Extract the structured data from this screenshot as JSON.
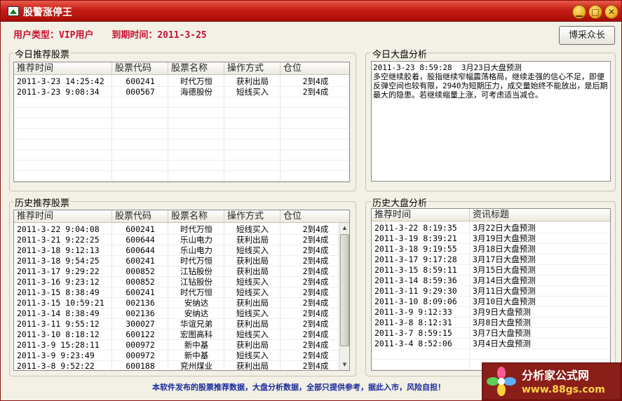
{
  "window": {
    "title": "股警涨停王",
    "controls": {
      "minimize": "▁",
      "maximize": "□",
      "close": "✕"
    }
  },
  "user_info": {
    "user_type_label": "用户类型：VIP用户",
    "expiry_label": "到期时间：2011-3-25"
  },
  "top_button": {
    "label": "博采众长"
  },
  "today_stocks": {
    "group_title": "今日推荐股票",
    "columns": [
      "推荐时间",
      "股票代码",
      "股票名称",
      "操作方式",
      "仓位"
    ],
    "rows": [
      [
        "2011-3-23 14:25:42",
        "600241",
        "时代万恒",
        "获利出局",
        "2到4成"
      ],
      [
        "2011-3-23 9:08:34",
        "000567",
        "海德股份",
        "短线买入",
        "2到4成"
      ]
    ]
  },
  "today_market": {
    "group_title": "今日大盘分析",
    "text": "2011-3-23 8:59:28  3月23日大盘预测\n多空继续胶着，股指继续窄幅震荡格局，继续走强的信心不足，即便反弹空间也较有限，2940为短期压力，成交量始终不能放出，是后期最大的隐患。若继续缩量上涨，可考虑适当减仓。"
  },
  "history_stocks": {
    "group_title": "历史推荐股票",
    "columns": [
      "推荐时间",
      "股票代码",
      "股票名称",
      "操作方式",
      "仓位"
    ],
    "rows": [
      [
        "2011-3-22 9:04:08",
        "600241",
        "时代万恒",
        "短线买入",
        "2到4成"
      ],
      [
        "2011-3-21 9:22:25",
        "600644",
        "乐山电力",
        "获利出局",
        "2到4成"
      ],
      [
        "2011-3-18 9:12:13",
        "600644",
        "乐山电力",
        "短线买入",
        "2到4成"
      ],
      [
        "2011-3-18 9:54:25",
        "600241",
        "时代万恒",
        "获利出局",
        "2到4成"
      ],
      [
        "2011-3-17 9:29:22",
        "000852",
        "江钻股份",
        "获利出局",
        "2到4成"
      ],
      [
        "2011-3-16 9:23:12",
        "000852",
        "江钻股份",
        "短线买入",
        "2到4成"
      ],
      [
        "2011-3-15 8:38:49",
        "600241",
        "时代万恒",
        "短线买入",
        "2到4成"
      ],
      [
        "2011-3-15 10:59:21",
        "002136",
        "安纳达",
        "获利出局",
        "2到4成"
      ],
      [
        "2011-3-14 8:38:49",
        "002136",
        "安纳达",
        "短线买入",
        "2到4成"
      ],
      [
        "2011-3-11 9:55:12",
        "300027",
        "华谊兄弟",
        "获利出局",
        "2到4成"
      ],
      [
        "2011-3-10 8:18:12",
        "600122",
        "宏图高科",
        "短线买入",
        "2到4成"
      ],
      [
        "2011-3-9 15:28:11",
        "000972",
        "新中基",
        "获利出局",
        "2到4成"
      ],
      [
        "2011-3-9 9:23:49",
        "000972",
        "新中基",
        "短线买入",
        "2到4成"
      ],
      [
        "2011-3-8 9:52:22",
        "600188",
        "兖州煤业",
        "获利出局",
        "2到4成"
      ]
    ]
  },
  "history_market": {
    "group_title": "历史大盘分析",
    "columns": [
      "推荐时间",
      "资讯标题"
    ],
    "rows": [
      [
        "2011-3-22 8:19:35",
        "3月22日大盘预测"
      ],
      [
        "2011-3-19 8:39:21",
        "3月19日大盘预测"
      ],
      [
        "2011-3-18 9:19:55",
        "3月18日大盘预测"
      ],
      [
        "2011-3-17 9:17:28",
        "3月17日大盘预测"
      ],
      [
        "2011-3-15 8:59:11",
        "3月15日大盘预测"
      ],
      [
        "2011-3-14 8:59:36",
        "3月14日大盘预测"
      ],
      [
        "2011-3-11 9:29:30",
        "3月11日大盘预测"
      ],
      [
        "2011-3-10 8:09:06",
        "3月10日大盘预测"
      ],
      [
        "2011-3-9 9:12:33",
        "3月9日大盘预测"
      ],
      [
        "2011-3-8 8:12:31",
        "3月8日大盘预测"
      ],
      [
        "2011-3-7 8:59:15",
        "3月7日大盘预测"
      ],
      [
        "2011-3-4 8:52:06",
        "3月4日大盘预测"
      ]
    ]
  },
  "footer": {
    "disclaimer": "本软件发布的股票推荐数据，大盘分析数据，全部只提供参考，据此入市，风险自担！"
  },
  "watermark": {
    "name": "分析家公式网",
    "url": "www.88gs.com"
  },
  "colors": {
    "title_bar": "#c61e16",
    "user_info_text": "#c8102e",
    "footer_text": "#1a2a9a",
    "window_bg": "#f3f1e6"
  }
}
